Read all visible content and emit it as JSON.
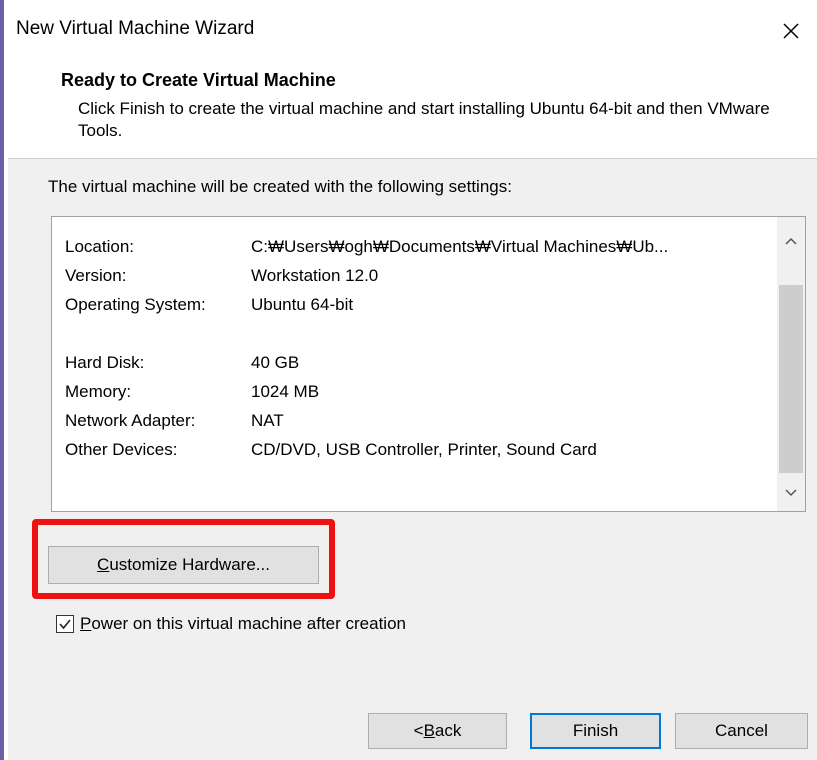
{
  "window": {
    "title": "New Virtual Machine Wizard",
    "close_icon": "close-icon"
  },
  "header": {
    "title": "Ready to Create Virtual Machine",
    "description": "Click Finish to create the virtual machine and start installing Ubuntu 64-bit and then VMware Tools."
  },
  "main": {
    "intro": "The virtual machine will be created with the following settings:",
    "settings": [
      {
        "key": "Location:",
        "value": "C:₩Users₩ogh₩Documents₩Virtual Machines₩Ub..."
      },
      {
        "key": "Version:",
        "value": "Workstation 12.0"
      },
      {
        "key": "Operating System:",
        "value": "Ubuntu 64-bit"
      },
      {
        "key": "Hard Disk:",
        "value": "40 GB"
      },
      {
        "key": "Memory:",
        "value": "1024 MB"
      },
      {
        "key": "Network Adapter:",
        "value": "NAT"
      },
      {
        "key": "Other Devices:",
        "value": "CD/DVD, USB Controller, Printer, Sound Card"
      }
    ],
    "customize_label_first": "C",
    "customize_label_rest": "ustomize Hardware...",
    "power_on_checked": true,
    "power_on_label_first": "P",
    "power_on_label_rest": "ower on this virtual machine after creation"
  },
  "footer": {
    "back_prefix": "< ",
    "back_underlined": "B",
    "back_rest": "ack",
    "finish_label": "Finish",
    "cancel_label": "Cancel"
  },
  "colors": {
    "highlight": "#ee1111",
    "default_button_border": "#0078d7",
    "window_edge": "#6b5fa8"
  }
}
